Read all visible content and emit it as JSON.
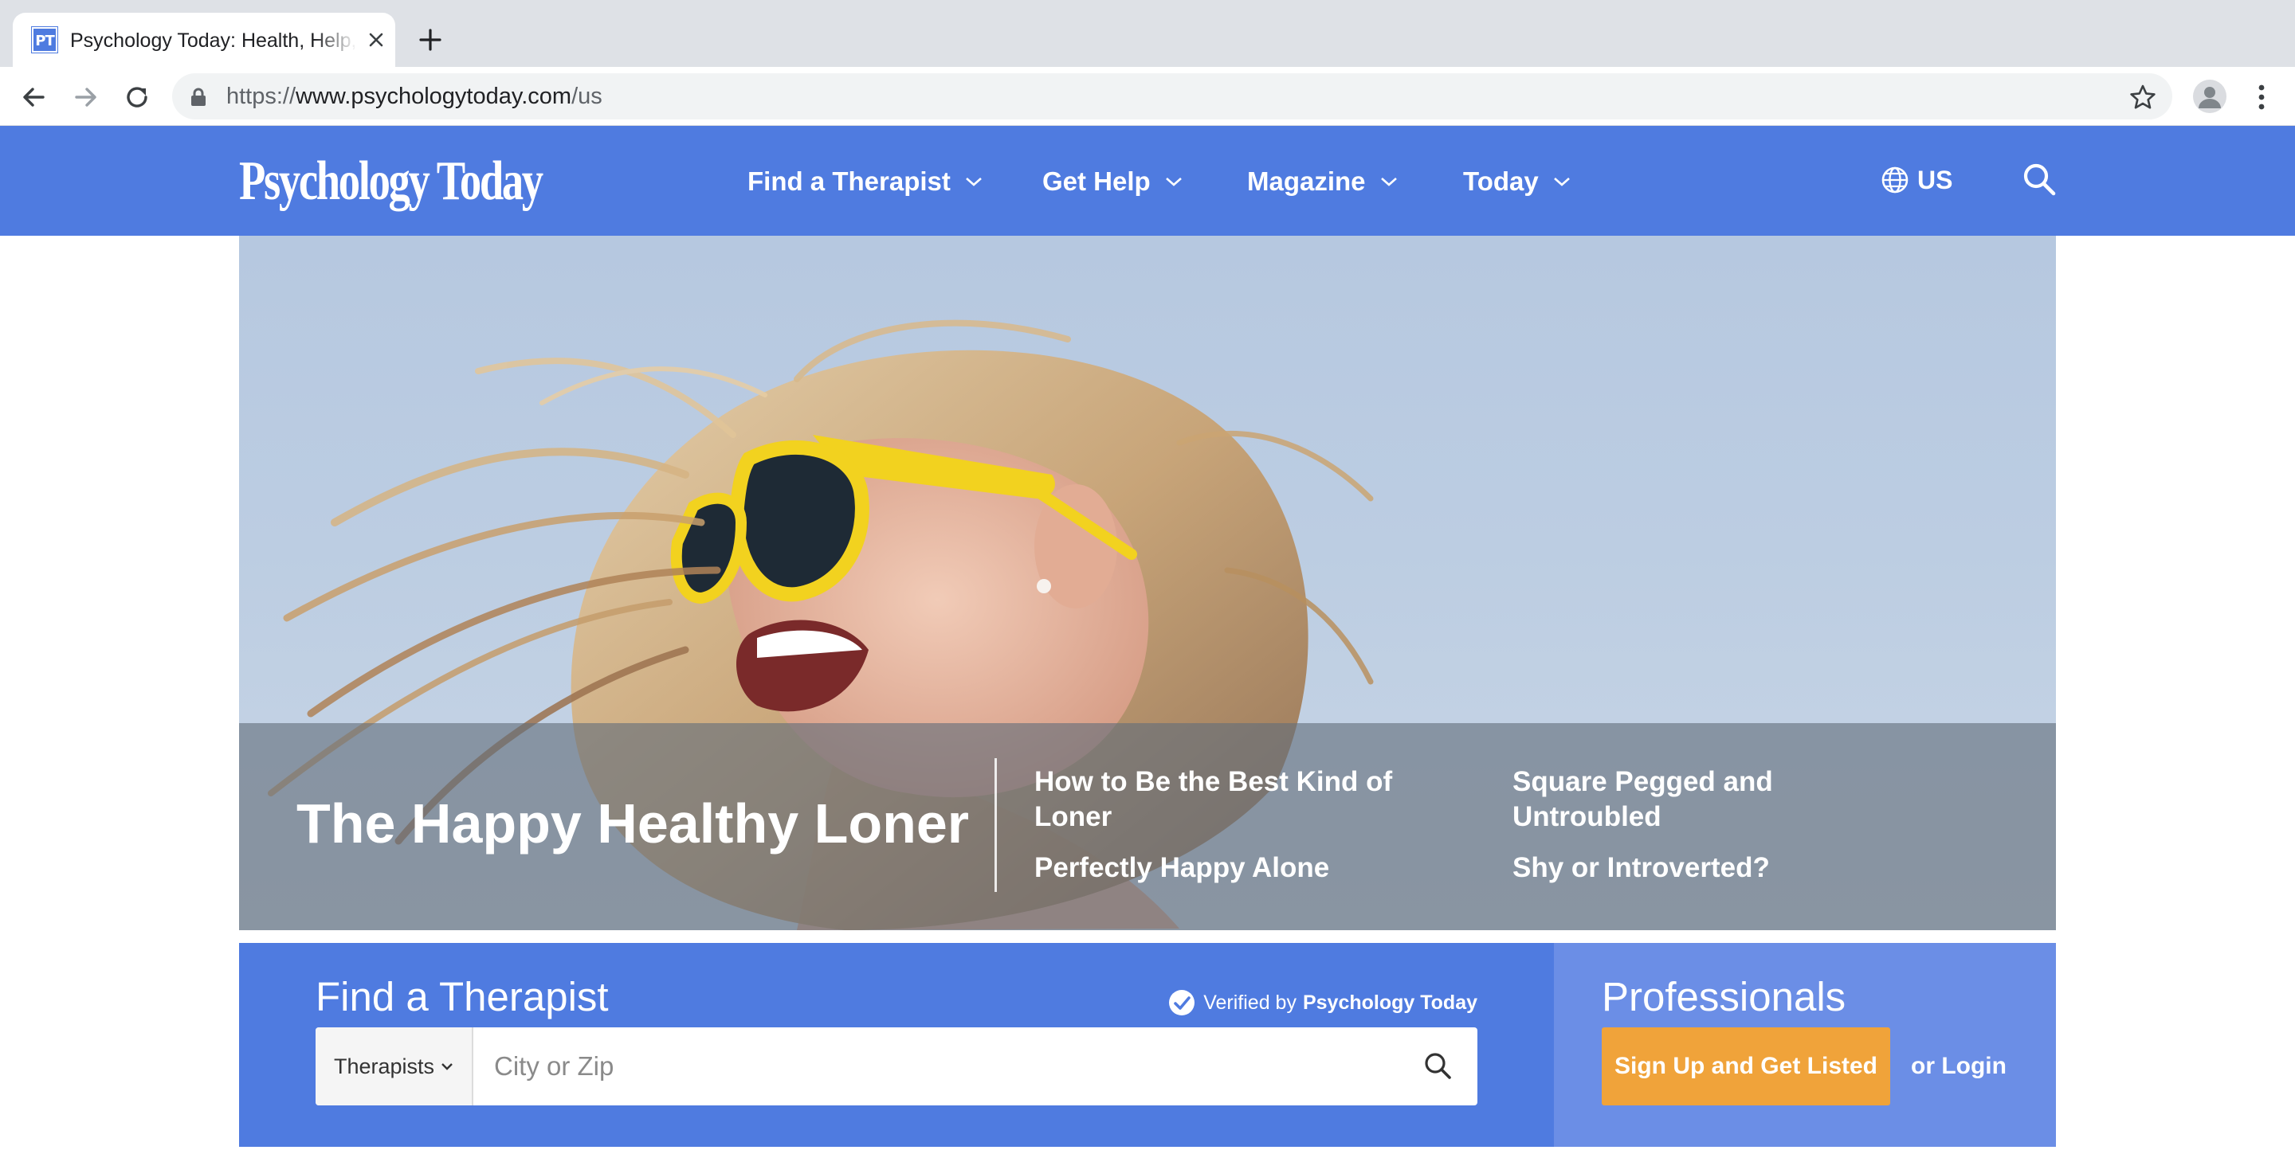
{
  "browser": {
    "tab_title": "Psychology Today: Health, Help, Happiness + Find a Therapist",
    "favicon_text": "PT",
    "url_scheme": "https://",
    "url_host": "www.psychologytoday.com",
    "url_path": "/us"
  },
  "header": {
    "logo": "Psychology Today",
    "nav": [
      "Find a Therapist",
      "Get Help",
      "Magazine",
      "Today"
    ],
    "region": "US",
    "brand_color": "#4f7be0"
  },
  "hero": {
    "title": "The Happy Healthy Loner",
    "links": [
      "How to Be the Best Kind of Loner",
      "Square Pegged and Untroubled",
      "Perfectly Happy Alone",
      "Shy or Introverted?"
    ]
  },
  "finder": {
    "title": "Find a Therapist",
    "verified_prefix": "Verified by",
    "verified_brand": "Psychology Today",
    "select_value": "Therapists",
    "placeholder": "City or Zip"
  },
  "professionals": {
    "title": "Professionals",
    "signup_label": "Sign Up and Get Listed",
    "login_label": "or Login",
    "accent_color": "#f0a33a"
  }
}
